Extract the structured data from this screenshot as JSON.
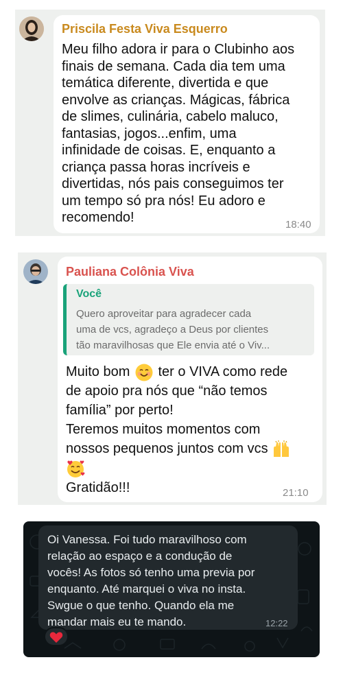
{
  "messages": [
    {
      "sender": "Priscila Festa Viva Esquerro",
      "sender_color": "#c98a1e",
      "lines": [
        "Meu filho adora ir para o Clubinho aos",
        "finais de semana. Cada dia tem uma",
        "temática diferente, divertida e que",
        "envolve as crianças. Mágicas, fábrica",
        "de slimes, culinária, cabelo maluco,",
        "fantasias, jogos...enfim, uma",
        "infinidade de coisas. E, enquanto a",
        "criança passa horas incríveis e",
        "divertidas, nós pais conseguimos ter",
        "um tempo só pra nós! Eu adoro e",
        "recomendo!"
      ],
      "time": "18:40"
    },
    {
      "sender": "Pauliana Colônia Viva",
      "sender_color": "#d9534f",
      "quote": {
        "author": "Você",
        "lines": [
          "Quero aproveitar para agradecer cada",
          "uma de vcs, agradeço a Deus por clientes",
          "tão maravilhosas que Ele envia até o Viv..."
        ]
      },
      "lines": {
        "l1a": "Muito bom",
        "l1b": "ter o VIVA como rede",
        "l2": "de apoio pra nós que “não temos",
        "l3": "família” por perto!",
        "l4": "Teremos muitos momentos com",
        "l5": "nossos pequenos juntos com vcs",
        "l7": "Gratidão!!!"
      },
      "emoji_icons": [
        "smiling-face-icon",
        "raising-hands-icon",
        "smiling-face-with-hearts-icon"
      ],
      "time": "21:10"
    },
    {
      "lines": [
        "Oi Vanessa. Foi tudo maravilhoso com",
        "relação ao espaço e a condução de",
        "vocês! As fotos só tenho uma previa por",
        "enquanto. Até marquei o viva no insta.",
        "Swgue o que tenho. Quando ela me",
        "mandar mais eu te mando."
      ],
      "time": "12:22",
      "reaction_icon": "red-heart-icon"
    }
  ]
}
